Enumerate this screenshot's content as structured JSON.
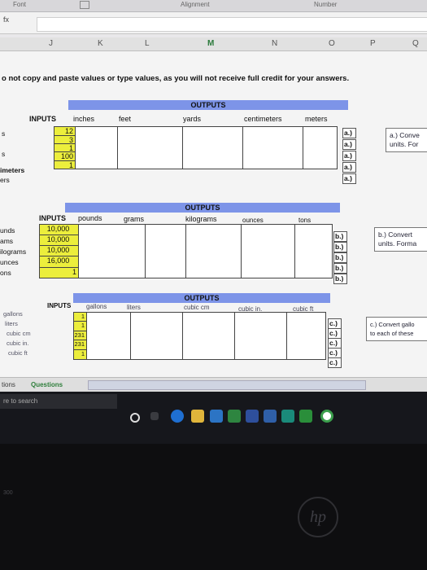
{
  "ribbon": {
    "font_label": "Font",
    "alignment_label": "Alignment",
    "number_label": "Number"
  },
  "formula": {
    "fx": "fx",
    "value": ""
  },
  "columns": [
    "J",
    "K",
    "L",
    "M",
    "N",
    "O",
    "P",
    "Q"
  ],
  "warning": "o not copy and paste values or type values, as you will not receive full credit for your answers.",
  "section_a": {
    "outputs_title": "OUTPUTS",
    "inputs_label": "INPUTS",
    "headers": [
      "inches",
      "feet",
      "yards",
      "centimeters",
      "meters"
    ],
    "row_labels": [
      "s",
      "",
      "s",
      "imeters",
      "ers"
    ],
    "inputs": [
      "12",
      "3",
      "1",
      "100",
      "1"
    ],
    "letters": [
      "a.)",
      "a.)",
      "a.)",
      "a.)",
      "a.)"
    ],
    "note_lines": [
      "a.) Conve",
      "units. For"
    ]
  },
  "section_b": {
    "outputs_title": "OUTPUTS",
    "inputs_label": "INPUTS",
    "headers": [
      "pounds",
      "grams",
      "kilograms",
      "ounces",
      "tons"
    ],
    "row_labels": [
      "unds",
      "ams",
      "ilograms",
      "unces",
      "ons"
    ],
    "inputs": [
      "10,000",
      "10,000",
      "10,000",
      "16,000",
      "1"
    ],
    "letters": [
      "b.)",
      "b.)",
      "b.)",
      "b.)",
      "b.)"
    ],
    "note_lines": [
      "b.) Convert",
      "units. Forma"
    ]
  },
  "section_c": {
    "outputs_title": "OUTPUTS",
    "inputs_label": "INPUTS",
    "headers": [
      "gallons",
      "liters",
      "cubic cm",
      "cubic in.",
      "cubic ft"
    ],
    "row_labels": [
      "gallons",
      "liters",
      "cubic cm",
      "cubic in.",
      "cubic ft"
    ],
    "inputs": [
      "1",
      "1",
      "231",
      "231",
      "1"
    ],
    "letters": [
      "c.)",
      "c.)",
      "c.)",
      "c.)",
      "c.)"
    ],
    "note_lines": [
      "c.) Convert gallo",
      "to each of these"
    ]
  },
  "tabs": {
    "first": "tions",
    "second": "Questions"
  },
  "taskbar": {
    "search_placeholder": "re to search"
  },
  "bezel": {
    "text": "300",
    "logo": "hp"
  }
}
